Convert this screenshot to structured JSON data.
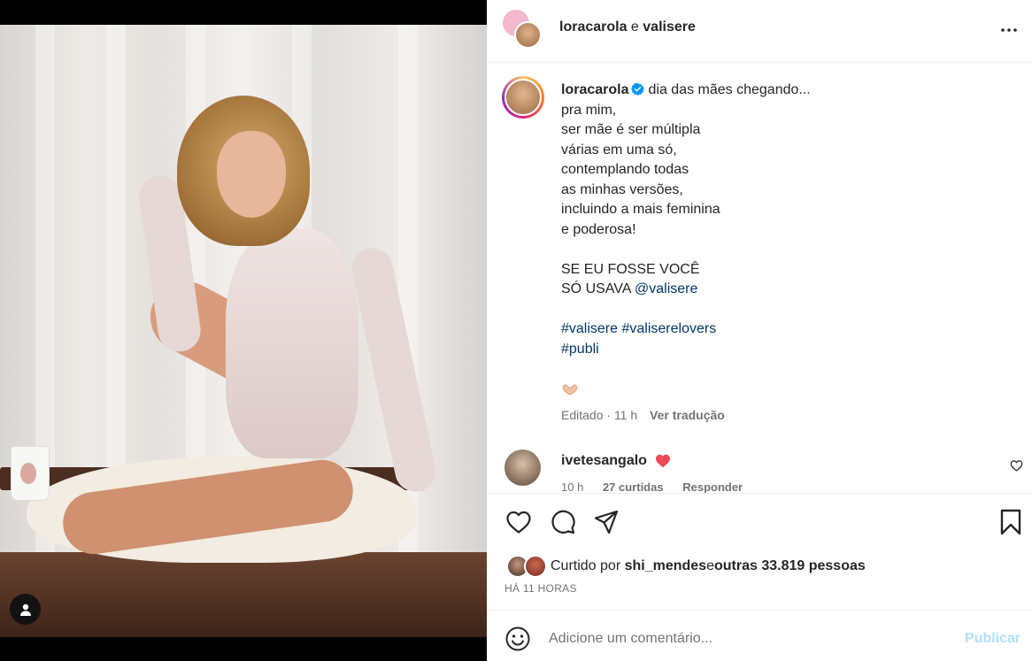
{
  "post": {
    "header": {
      "author": "loracarola",
      "connector": " e ",
      "collaborator": "valisere",
      "more_icon": "more-horizontal-icon"
    },
    "caption": {
      "username": "loracarola",
      "verified": true,
      "lines": [
        "dia das mães chegando...",
        "pra mim,",
        "ser mãe é ser múltipla",
        "várias em uma só,",
        "contemplando todas",
        "as minhas versões,",
        "incluindo a mais feminina",
        "e poderosa!"
      ],
      "line_upper_1": "SE EU FOSSE VOCÊ",
      "line_upper_2_prefix": "SÓ USAVA ",
      "mention": "@valisere",
      "hashtag_1": "#valisere",
      "hashtag_2": "#valiserelovers",
      "hashtag_3": "#publi",
      "emoji": "hand-heart-emoji"
    },
    "meta": {
      "edited_label": "Editado",
      "separator": "·",
      "time_ago": "11 h",
      "translate_label": "Ver tradução"
    },
    "comment": {
      "username": "ivetesangalo",
      "emoji": "red-heart-emoji",
      "time_ago": "10 h",
      "likes_label": "27 curtidas",
      "reply_label": "Responder"
    },
    "likes": {
      "prefix": "Curtido por ",
      "first_liker": "shi_mendes",
      "middle": " e ",
      "others": "outras 33.819 pessoas"
    },
    "timestamp": "HÁ 11 HORAS",
    "composer": {
      "placeholder": "Adicione um comentário...",
      "submit_label": "Publicar"
    },
    "colors": {
      "link": "#00376b",
      "muted": "#737373",
      "publish_disabled": "#b2dffc",
      "verified": "#0095f6",
      "heart": "#ed4956"
    }
  }
}
